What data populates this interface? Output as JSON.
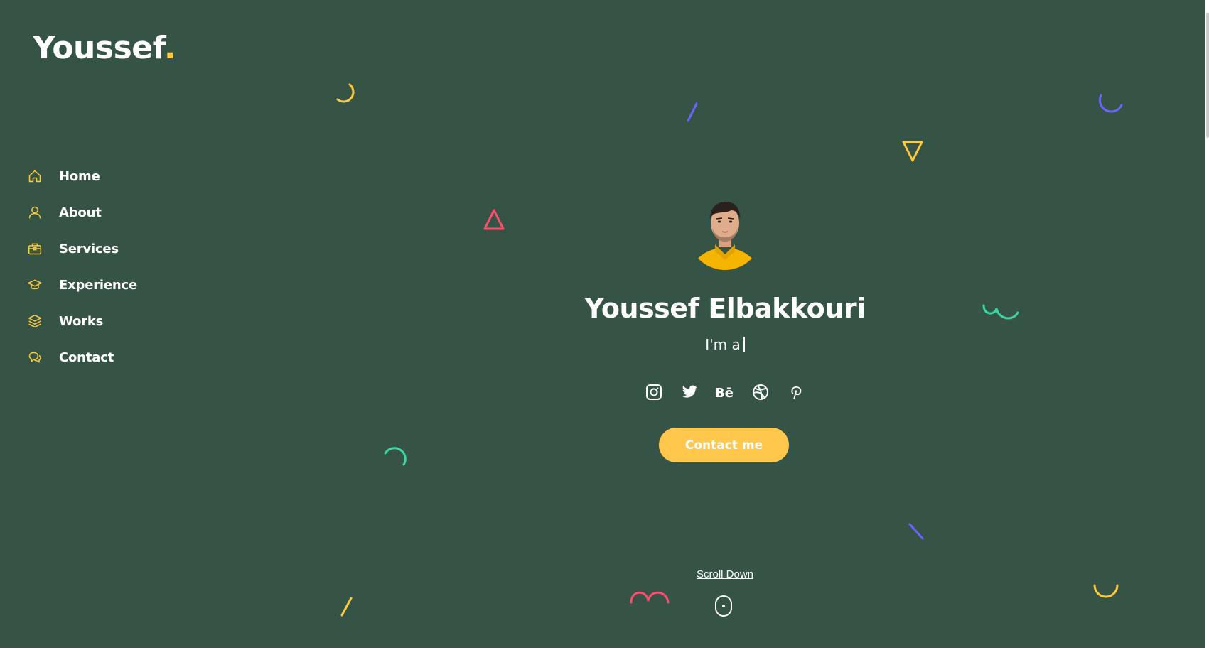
{
  "logo": {
    "main": "Youssef",
    "dot": "."
  },
  "nav": {
    "items": [
      {
        "label": "Home",
        "icon": "home-icon"
      },
      {
        "label": "About",
        "icon": "user-icon"
      },
      {
        "label": "Services",
        "icon": "briefcase-icon"
      },
      {
        "label": "Experience",
        "icon": "graduation-cap-icon"
      },
      {
        "label": "Works",
        "icon": "layers-icon"
      },
      {
        "label": "Contact",
        "icon": "chat-icon"
      }
    ]
  },
  "hero": {
    "name": "Youssef Elbakkouri",
    "typed_prefix": "I'm a",
    "socials": [
      "instagram-icon",
      "twitter-icon",
      "behance-icon",
      "dribbble-icon",
      "pinterest-icon"
    ],
    "cta_label": "Contact me"
  },
  "scroll": {
    "label": "Scroll Down"
  },
  "colors": {
    "background": "#355446",
    "accent": "#ffc93e",
    "text": "#ffffff",
    "shape_red": "#ff4d6d",
    "shape_blue": "#6c63ff",
    "shape_green": "#3bd8a6"
  }
}
